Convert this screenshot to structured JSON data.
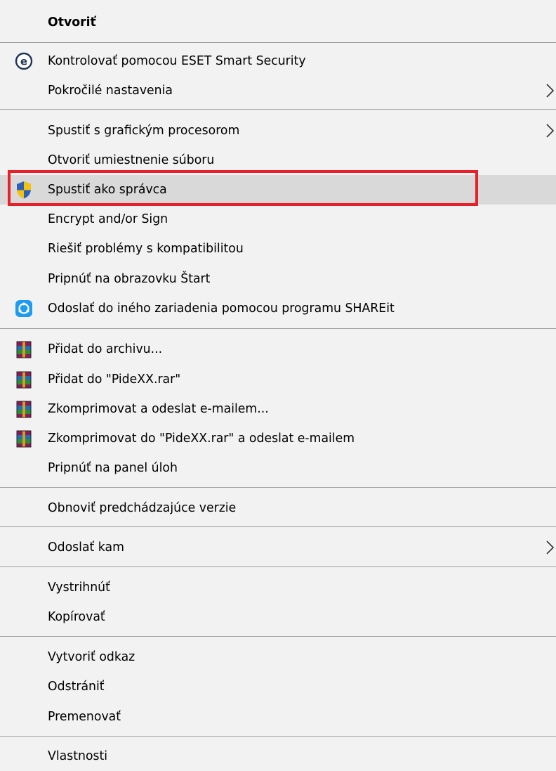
{
  "menu": {
    "items": {
      "open": {
        "label": "Otvoriť"
      },
      "eset_scan": {
        "label": "Kontrolovať pomocou ESET Smart Security",
        "icon": "eset-icon"
      },
      "advanced": {
        "label": "Pokročilé nastavenia",
        "has_submenu": true
      },
      "run_gpu": {
        "label": "Spustiť s grafickým procesorom",
        "has_submenu": true
      },
      "open_location": {
        "label": "Otvoriť umiestnenie súboru"
      },
      "run_as_admin": {
        "label": "Spustiť ako správca",
        "icon": "uac-shield-icon",
        "highlighted": true
      },
      "encrypt_sign": {
        "label": "Encrypt and/or Sign"
      },
      "troubleshoot": {
        "label": "Riešiť problémy s kompatibilitou"
      },
      "pin_start": {
        "label": "Pripnúť na obrazovku Štart"
      },
      "shareit": {
        "label": "Odoslať do iného zariadenia pomocou programu SHAREit",
        "icon": "shareit-icon"
      },
      "add_archive": {
        "label": "Přidat do archivu...",
        "icon": "winrar-icon"
      },
      "add_rar": {
        "label": "Přidat do \"PideXX.rar\"",
        "icon": "winrar-icon"
      },
      "compress_email": {
        "label": "Zkomprimovat a odeslat e-mailem...",
        "icon": "winrar-icon"
      },
      "compress_rar_email": {
        "label": "Zkomprimovat do \"PideXX.rar\" a odeslat e-mailem",
        "icon": "winrar-icon"
      },
      "pin_taskbar": {
        "label": "Pripnúť na panel úloh"
      },
      "restore_versions": {
        "label": "Obnoviť predchádzajúce verzie"
      },
      "send_to": {
        "label": "Odoslať kam",
        "has_submenu": true
      },
      "cut": {
        "label": "Vystrihnúť"
      },
      "copy": {
        "label": "Kopírovať"
      },
      "create_shortcut": {
        "label": "Vytvoriť odkaz"
      },
      "delete": {
        "label": "Odstrániť"
      },
      "rename": {
        "label": "Premenovať"
      },
      "properties": {
        "label": "Vlastnosti"
      }
    }
  },
  "colors": {
    "menu_background": "#f2f2f2",
    "hover_background": "#d9d9d9",
    "separator": "#a0a0a0",
    "annotation_border": "#e8202a"
  }
}
